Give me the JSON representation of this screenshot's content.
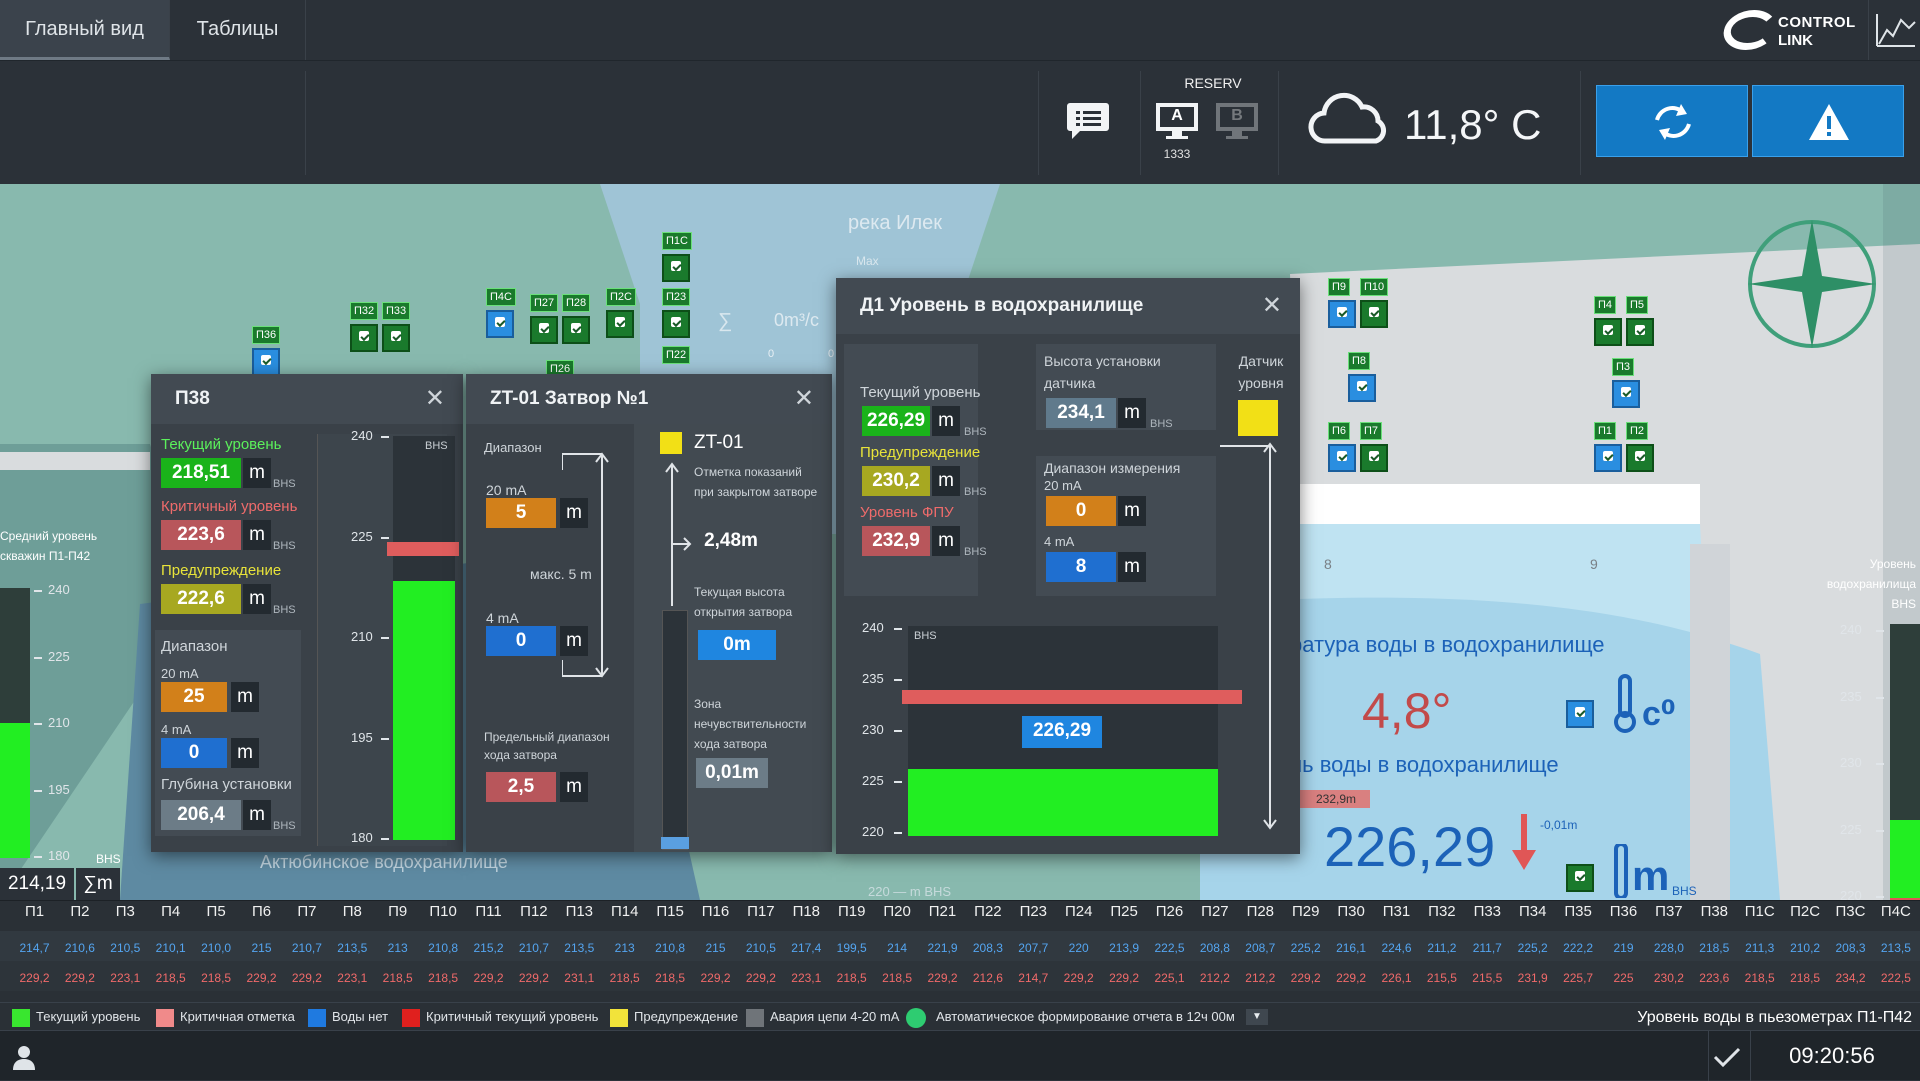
{
  "nav": {
    "tabs": [
      "Главный вид",
      "Таблицы"
    ],
    "logo_line1": "CONTROL",
    "logo_line2": "LINK"
  },
  "toolbar": {
    "reserv_label": "RESERV",
    "server_a": "A",
    "server_b": "B",
    "server_id": "1333",
    "temperature": "11,8° C"
  },
  "map": {
    "river_label": "река Илек",
    "max_label": "Max",
    "flow_label": "0m³/c",
    "flow_ticks": [
      "0",
      "0"
    ],
    "reservoir_name": "Актюбинское водохранилище",
    "sectors": [
      "8",
      "9"
    ],
    "left_scale_title": "Средний уровень скважин П1-П42",
    "left_scale_ticks": [
      "240",
      "225",
      "210",
      "195",
      "180"
    ],
    "left_scale_unit": "BHS",
    "left_total": "214,19",
    "left_sum_btn": "∑m",
    "right_scale_title": "Уровень водохранилища BHS",
    "right_scale_ticks": [
      "240",
      "235",
      "230",
      "225",
      "220"
    ],
    "water_temp_label": "ратура воды в водохранилище",
    "water_temp_value": "4,8°",
    "temp_unit": "c⁰",
    "water_level_label": "нь воды в водохранилище",
    "water_level_value": "226,29",
    "level_marker": "232,9m",
    "level_delta": "-0,01m",
    "level_unit": "m",
    "level_unit_sub": "BHS",
    "bottom_scale": "220 — m BHS",
    "tags": [
      "П1С",
      "П23",
      "П22",
      "П4С",
      "П27",
      "П28",
      "П2С",
      "П26",
      "П32",
      "П33",
      "П36",
      "П9",
      "П10",
      "П8",
      "П6",
      "П7",
      "П4",
      "П5",
      "П3",
      "П1",
      "П2"
    ]
  },
  "p38": {
    "title": "П38",
    "current_label": "Текущий уровень",
    "current": "218,51",
    "critical_label": "Критичный уровень",
    "critical": "223,6",
    "warn_label": "Предупреждение",
    "warn": "222,6",
    "range_label": "Диапазон",
    "ma20_label": "20 mA",
    "ma20": "25",
    "ma4_label": "4 mA",
    "ma4": "0",
    "depth_label": "Глубина установки",
    "depth": "206,4",
    "unit": "m",
    "bhs": "BHS",
    "scale_ticks": [
      "240",
      "225",
      "210",
      "195",
      "180"
    ],
    "level_fraction": 0.64
  },
  "zt": {
    "title": "ZT-01 Затвор №1",
    "range_label": "Диапазон",
    "ma20_label": "20 mA",
    "ma20": "5",
    "max_label": "макс. 5 m",
    "ma4_label": "4 mA",
    "ma4": "0",
    "limit_label": "Предельный диапазон хода затвора",
    "limit": "2,5",
    "unit": "m",
    "sensor": "ZT-01",
    "closed_label": "Отметка показаний при закрытом затворе",
    "closed_value": "2,48m",
    "height_label": "Текущая высота открытия затвора",
    "height_value": "0m",
    "zone_label": "Зона нечувствительности хода затвора",
    "zone_value": "0,01m"
  },
  "d1": {
    "title": "Д1 Уровень в водохранилище",
    "current_label": "Текущий уровень",
    "current": "226,29",
    "warn_label": "Предупреждение",
    "warn": "230,2",
    "fpu_label": "Уровень ФПУ",
    "fpu": "232,9",
    "install_label": "Высота установки датчика",
    "install": "234,1",
    "sensor_label": "Датчик уровня",
    "range_label": "Диапазон измерения",
    "ma20_label": "20 mA",
    "ma20": "0",
    "ma4_label": "4 mA",
    "ma4": "8",
    "unit": "m",
    "bhs": "BHS",
    "scale_ticks": [
      "240",
      "235",
      "230",
      "225",
      "220"
    ],
    "chart_value": "226,29",
    "level_fraction": 0.32
  },
  "table": {
    "headers": [
      "П1",
      "П2",
      "П3",
      "П4",
      "П5",
      "П6",
      "П7",
      "П8",
      "П9",
      "П10",
      "П11",
      "П12",
      "П13",
      "П14",
      "П15",
      "П16",
      "П17",
      "П18",
      "П19",
      "П20",
      "П21",
      "П22",
      "П23",
      "П24",
      "П25",
      "П26",
      "П27",
      "П28",
      "П29",
      "П30",
      "П31",
      "П32",
      "П33",
      "П34",
      "П35",
      "П36",
      "П37",
      "П38",
      "П1С",
      "П2С",
      "П3С",
      "П4С"
    ],
    "current": [
      "214,7",
      "210,6",
      "210,5",
      "210,1",
      "210,0",
      "215",
      "210,7",
      "213,5",
      "213",
      "210,8",
      "215,2",
      "210,7",
      "213,5",
      "213",
      "210,8",
      "215",
      "210,5",
      "217,4",
      "199,5",
      "214",
      "221,9",
      "208,3",
      "207,7",
      "220",
      "213,9",
      "222,5",
      "208,8",
      "208,7",
      "225,2",
      "216,1",
      "224,6",
      "211,2",
      "211,7",
      "225,2",
      "222,2",
      "219",
      "228,0",
      "218,5",
      "211,3",
      "210,2",
      "208,3",
      "213,5"
    ],
    "critical": [
      "229,2",
      "229,2",
      "223,1",
      "218,5",
      "218,5",
      "229,2",
      "229,2",
      "223,1",
      "218,5",
      "218,5",
      "229,2",
      "229,2",
      "231,1",
      "218,5",
      "218,5",
      "229,2",
      "229,2",
      "223,1",
      "218,5",
      "218,5",
      "229,2",
      "212,6",
      "214,7",
      "229,2",
      "229,2",
      "225,1",
      "212,2",
      "212,2",
      "229,2",
      "229,2",
      "226,1",
      "215,5",
      "215,5",
      "231,9",
      "225,7",
      "225",
      "230,2",
      "223,6",
      "218,5",
      "218,5",
      "234,2",
      "222,5"
    ]
  },
  "legend": {
    "items": [
      "Текущий уровень",
      "Критичная отметка",
      "Воды нет",
      "Критичный текущий уровень",
      "Предупреждение",
      "Авария цепи 4-20 mA"
    ],
    "colors": [
      "#39e62f",
      "#f08a8a",
      "#1f7ae0",
      "#e0201e",
      "#f2e33a",
      "#6f7479"
    ],
    "auto_report": "Автоматическое формирование отчета в 12ч 00м",
    "caption": "Уровень воды в пьезометрах П1-П42"
  },
  "status": {
    "time": "09:20:56"
  }
}
